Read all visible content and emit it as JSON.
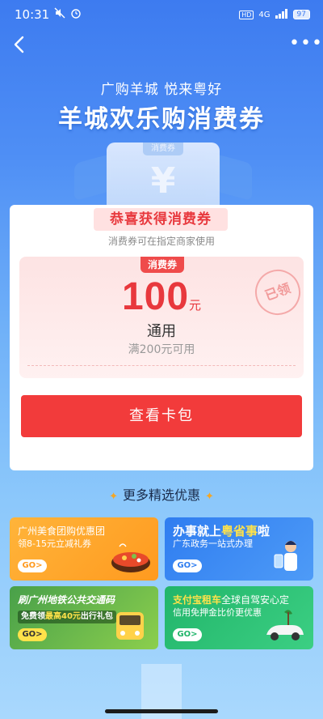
{
  "status_bar": {
    "time": "10:31",
    "network": "4G",
    "hd": "HD",
    "battery": "97"
  },
  "nav": {
    "back_icon": "back-arrow-icon",
    "more_label": "•••"
  },
  "hero": {
    "subtitle": "广购羊城 悦来粤好",
    "title": "羊城欢乐购消费券",
    "deco_tag": "消费券",
    "deco_symbol": "¥"
  },
  "card": {
    "congrats": "恭喜获得消费券",
    "hint": "消费券可在指定商家使用",
    "coupon": {
      "tag": "消费券",
      "amount": "100",
      "unit": "元",
      "type": "通用",
      "condition": "满200元可用",
      "stamp": "已领"
    },
    "button_label": "查看卡包"
  },
  "section": {
    "title": "更多精选优惠",
    "spark": "✦"
  },
  "promos": [
    {
      "line1": "广州美食团购优惠团",
      "line2": "领8-15元立减礼券",
      "go": "GO>"
    },
    {
      "line1_a": "办事就上",
      "line1_b": "粤省事",
      "line1_c": "啦",
      "line2": "广东政务一站式办理",
      "go": "GO>"
    },
    {
      "line1": "刷广州地铁公共交通码",
      "line2_a": "免费领",
      "line2_b": "最高40元",
      "line2_c": "出行礼包",
      "go": "GO>"
    },
    {
      "line1_a": "支付宝租车",
      "line1_b": "全球自驾安心定",
      "line2": "信用免押金比价更优惠",
      "go": "GO>"
    }
  ],
  "colors": {
    "accent_red": "#f23b3b",
    "bg_blue": "#3d7bf0"
  }
}
